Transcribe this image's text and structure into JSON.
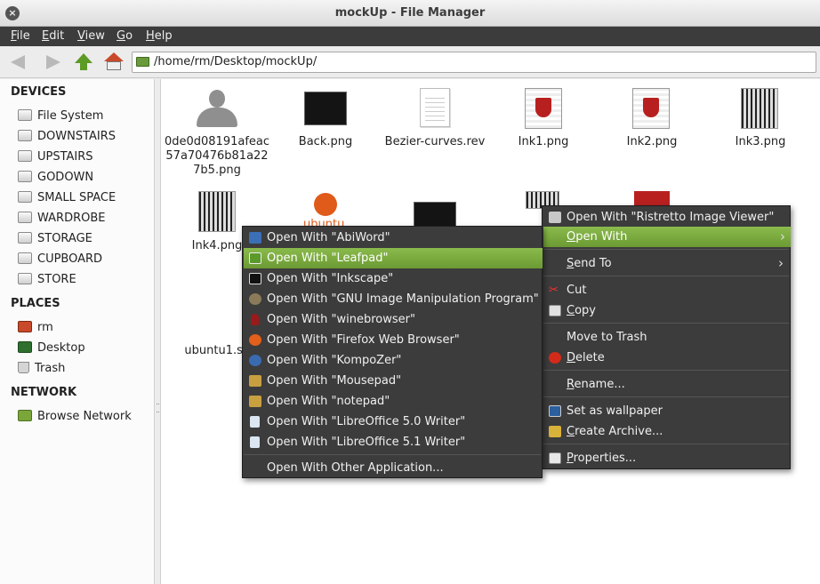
{
  "window": {
    "title": "mockUp - File Manager"
  },
  "menubar": [
    "File",
    "Edit",
    "View",
    "Go",
    "Help"
  ],
  "toolbar": {
    "path": "/home/rm/Desktop/mockUp/"
  },
  "sidebar": {
    "devices_heading": "DEVICES",
    "devices": [
      "File System",
      "DOWNSTAIRS",
      "UPSTAIRS",
      "GODOWN",
      "SMALL SPACE",
      "WARDROBE",
      "STORAGE",
      "CUPBOARD",
      "STORE"
    ],
    "places_heading": "PLACES",
    "places": [
      "rm",
      "Desktop",
      "Trash"
    ],
    "network_heading": "NETWORK",
    "network": [
      "Browse Network"
    ]
  },
  "files": {
    "row1": [
      {
        "name": "0de0d08191afeac57a70476b81a227b5.png"
      },
      {
        "name": "Back.png"
      },
      {
        "name": "Bezier-curves.rev"
      },
      {
        "name": "Ink1.png"
      },
      {
        "name": "Ink2.png"
      },
      {
        "name": "Ink3.png"
      }
    ],
    "row2": [
      {
        "name": "Ink4.png"
      },
      {
        "name": "ubuntu1.sv"
      }
    ],
    "ubuntu_thumb_text": "ubuntu"
  },
  "context_menu": {
    "items": [
      {
        "label": "Open With \"Ristretto Image Viewer\"",
        "icon": "ristretto-icon"
      },
      {
        "label": "Open With",
        "icon": "",
        "submenu": true,
        "active": true
      },
      {
        "label": "Send To",
        "icon": "",
        "submenu": true
      },
      {
        "label": "Cut",
        "icon": "scissors-icon"
      },
      {
        "label": "Copy",
        "icon": "copy-icon"
      },
      {
        "label": "Move to Trash",
        "icon": ""
      },
      {
        "label": "Delete",
        "icon": "delete-icon"
      },
      {
        "label": "Rename...",
        "icon": ""
      },
      {
        "label": "Set as wallpaper",
        "icon": "wallpaper-icon"
      },
      {
        "label": "Create Archive...",
        "icon": "archive-icon"
      },
      {
        "label": "Properties...",
        "icon": "properties-icon"
      }
    ]
  },
  "open_with_menu": {
    "items": [
      {
        "label": "Open With \"AbiWord\"",
        "icon": "abiword-icon",
        "color": "#3b6fb6"
      },
      {
        "label": "Open With \"Leafpad\"",
        "icon": "leafpad-icon",
        "color": "#5a9a2a",
        "active": true
      },
      {
        "label": "Open With \"Inkscape\"",
        "icon": "inkscape-icon",
        "color": "#111111"
      },
      {
        "label": "Open With \"GNU Image Manipulation Program\"",
        "icon": "gimp-icon",
        "color": "#8a7a5a"
      },
      {
        "label": "Open With \"winebrowser\"",
        "icon": "wine-icon",
        "color": "#9a1a1a"
      },
      {
        "label": "Open With \"Firefox Web Browser\"",
        "icon": "firefox-icon",
        "color": "#e2601a"
      },
      {
        "label": "Open With \"KompoZer\"",
        "icon": "kompozer-icon",
        "color": "#3a6ab0"
      },
      {
        "label": "Open With \"Mousepad\"",
        "icon": "mousepad-icon",
        "color": "#c8a040"
      },
      {
        "label": "Open With \"notepad\"",
        "icon": "notepad-icon",
        "color": "#c8a040"
      },
      {
        "label": "Open With \"LibreOffice 5.0 Writer\"",
        "icon": "writer-icon",
        "color": "#dbe6f2"
      },
      {
        "label": "Open With \"LibreOffice 5.1 Writer\"",
        "icon": "writer-icon",
        "color": "#dbe6f2"
      },
      {
        "label": "Open With Other Application...",
        "icon": ""
      }
    ]
  },
  "colors": {
    "accent": "#7aab3e",
    "menu_bg": "#3c3c3c"
  }
}
